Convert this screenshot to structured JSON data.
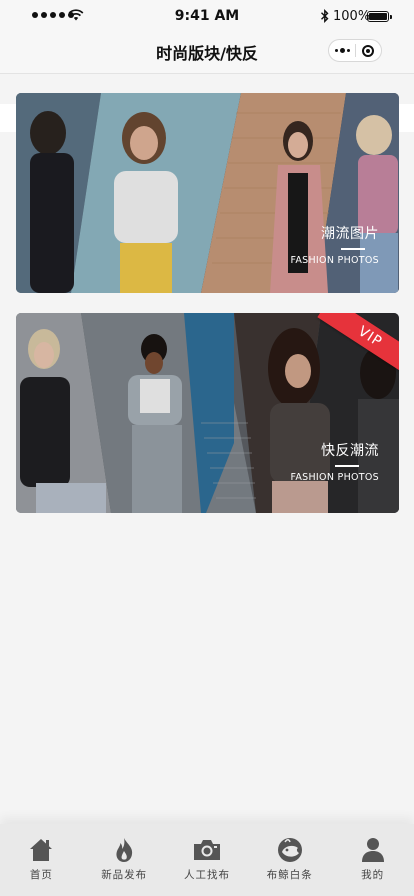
{
  "status_bar": {
    "time": "9:41 AM",
    "battery_text": "100%",
    "battery_level": 1.0
  },
  "nav": {
    "title": "时尚版块/快反",
    "icons": [
      "more-icon",
      "close-miniprogram-icon"
    ]
  },
  "cards": [
    {
      "title": "潮流图片",
      "subtitle": "FASHION PHOTOS",
      "badge": ""
    },
    {
      "title": "快反潮流",
      "subtitle": "FASHION PHOTOS",
      "badge": "VIP"
    }
  ],
  "tabs": [
    {
      "label": "首页",
      "icon": "home-icon"
    },
    {
      "label": "新品发布",
      "icon": "flame-icon"
    },
    {
      "label": "人工找布",
      "icon": "camera-icon"
    },
    {
      "label": "布鲸白条",
      "icon": "whale-icon"
    },
    {
      "label": "我的",
      "icon": "person-icon"
    }
  ],
  "colors": {
    "accent_red": "#e6333b",
    "tab_icon": "#555555",
    "background": "#f4f4f4"
  }
}
